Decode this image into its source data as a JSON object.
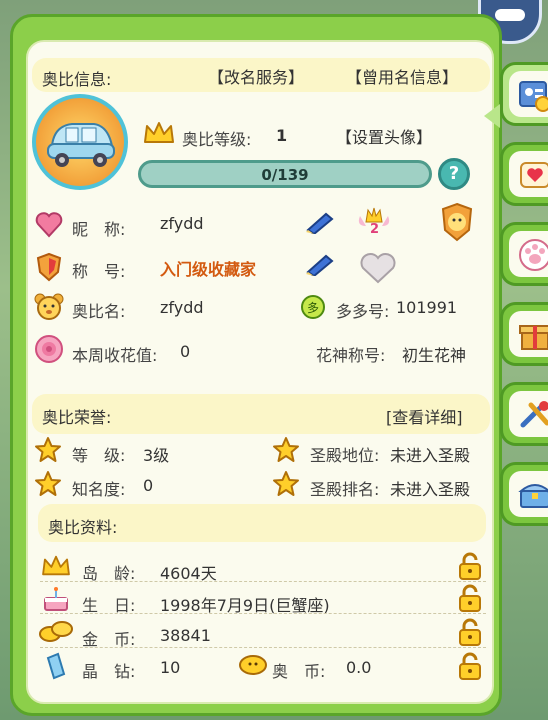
{
  "header": {
    "title": "奥比信息:",
    "rename_link": "【改名服务】",
    "former_names_link": "【曾用名信息】"
  },
  "profile": {
    "level_label": "奥比等级:",
    "level_value": "1",
    "set_avatar_link": "【设置头像】",
    "exp_text": "0/139",
    "exp_progress": 0
  },
  "fields": {
    "nickname_label": "昵　称:",
    "nickname_value": "zfydd",
    "title_label": "称　号:",
    "title_value": "入门级收藏家",
    "aobi_name_label": "奥比名:",
    "aobi_name_value": "zfydd",
    "duoduo_label": "多多号:",
    "duoduo_value": "101991",
    "flower_label": "本周收花值:",
    "flower_value": "0",
    "flower_god_label": "花神称号:",
    "flower_god_value": "初生花神",
    "badge_number": "2"
  },
  "honor": {
    "title": "奥比荣誉:",
    "detail_link": "[查看详细]",
    "level_label": "等　级:",
    "level_value": "3级",
    "palace_pos_label": "圣殿地位:",
    "palace_pos_value": "未进入圣殿",
    "fame_label": "知名度:",
    "fame_value": "0",
    "palace_rank_label": "圣殿排名:",
    "palace_rank_value": "未进入圣殿"
  },
  "info": {
    "title": "奥比资料:",
    "island_age_label": "岛　龄:",
    "island_age_value": "4604天",
    "birthday_label": "生　日:",
    "birthday_value": "1998年7月9日(巨蟹座)",
    "gold_label": "金　币:",
    "gold_value": "38841",
    "crystal_label": "晶　钻:",
    "crystal_value": "10",
    "aobi_coin_label": "奥　币:",
    "aobi_coin_value": "0.0"
  },
  "colors": {
    "frame_green": "#8ccf4a",
    "title_text_orange": "#e06a10",
    "exp_bar_teal": "#5fa89a"
  }
}
